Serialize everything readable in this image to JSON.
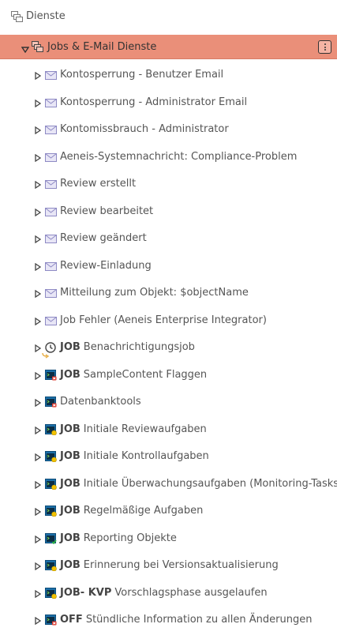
{
  "tree": {
    "root": {
      "label": "Dienste",
      "icon": "services-icon"
    },
    "selected": {
      "label": "Jobs & E-Mail Dienste",
      "icon": "services-icon",
      "menu_icon": "kebab-menu-icon"
    },
    "items": [
      {
        "prefix": "",
        "label": "Kontosperrung - Benutzer Email",
        "icon": "envelope-icon"
      },
      {
        "prefix": "",
        "label": "Kontosperrung - Administrator Email",
        "icon": "envelope-icon"
      },
      {
        "prefix": "",
        "label": "Kontomissbrauch - Administrator",
        "icon": "envelope-icon"
      },
      {
        "prefix": "",
        "label": "Aeneis-Systemnachricht: Compliance-Problem",
        "icon": "envelope-icon"
      },
      {
        "prefix": "",
        "label": "Review erstellt",
        "icon": "envelope-icon"
      },
      {
        "prefix": "",
        "label": "Review bearbeitet",
        "icon": "envelope-icon"
      },
      {
        "prefix": "",
        "label": "Review geändert",
        "icon": "envelope-icon"
      },
      {
        "prefix": "",
        "label": "Review-Einladung",
        "icon": "envelope-icon"
      },
      {
        "prefix": "",
        "label": "Mitteilung zum Objekt: $objectName",
        "icon": "envelope-icon"
      },
      {
        "prefix": "",
        "label": "Job Fehler (Aeneis Enterprise Integrator)",
        "icon": "envelope-icon"
      },
      {
        "prefix": "JOB",
        "label": "Benachrichtigungsjob",
        "icon": "clock-icon"
      },
      {
        "prefix": "JOB",
        "label": "SampleContent Flaggen",
        "icon": "terminal-red-icon"
      },
      {
        "prefix": "",
        "label": "Datenbanktools",
        "icon": "terminal-red-icon"
      },
      {
        "prefix": "JOB",
        "label": "Initiale Reviewaufgaben",
        "icon": "terminal-yellow-icon"
      },
      {
        "prefix": "JOB",
        "label": "Initiale Kontrollaufgaben",
        "icon": "terminal-yellow-icon"
      },
      {
        "prefix": "JOB",
        "label": "Initiale Überwachungsaufgaben (Monitoring-Tasks)",
        "icon": "terminal-yellow-icon"
      },
      {
        "prefix": "JOB",
        "label": "Regelmäßige Aufgaben",
        "icon": "terminal-yellow-icon"
      },
      {
        "prefix": "JOB",
        "label": "Reporting Objekte",
        "icon": "terminal-green-icon"
      },
      {
        "prefix": "JOB",
        "label": "Erinnerung bei Versionsaktualisierung",
        "icon": "terminal-yellow-icon"
      },
      {
        "prefix": "JOB- KVP",
        "label": "Vorschlagsphase ausgelaufen",
        "icon": "terminal-yellow-icon"
      },
      {
        "prefix": "OFF",
        "label": "Stündliche Information zu allen Änderungen",
        "icon": "terminal-red-icon"
      }
    ]
  },
  "colors": {
    "selected_bg": "#ea8f79",
    "text": "#555555",
    "envelope": "#9b98cc",
    "terminal": "#1b6fa8"
  }
}
